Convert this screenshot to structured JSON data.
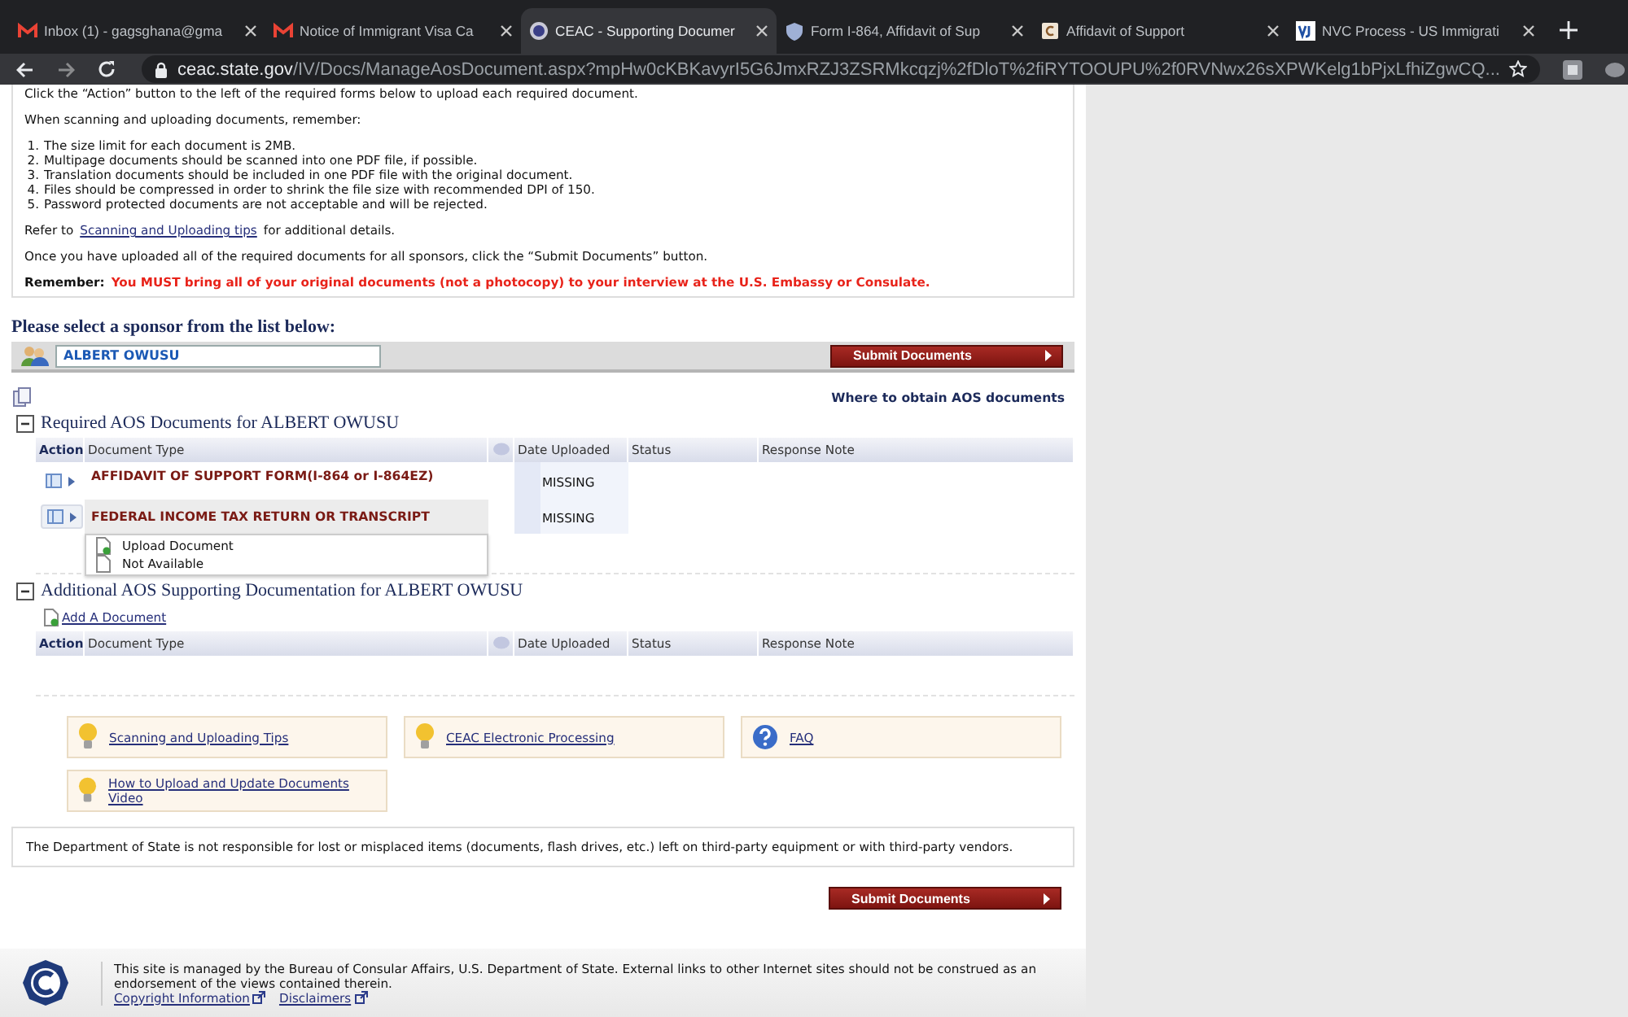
{
  "browser": {
    "tabs": [
      {
        "title": "Inbox (1) - gagsghana@gma",
        "kind": "gmail",
        "selected": false
      },
      {
        "title": "Notice of Immigrant Visa Ca",
        "kind": "gmail",
        "selected": false
      },
      {
        "title": "CEAC - Supporting Documer",
        "kind": "seal",
        "selected": true
      },
      {
        "title": "Form I-864, Affidavit of Sup",
        "kind": "shield",
        "selected": false
      },
      {
        "title": "Affidavit of Support",
        "kind": "letter",
        "selected": false
      },
      {
        "title": "NVC Process - US Immigrati",
        "kind": "vj",
        "selected": false
      }
    ],
    "address": {
      "domain": "ceac.state.gov",
      "path": "/IV/Docs/ManageAosDocument.aspx?mpHw0cKBKavyrI5G6JmxRZJ3ZSRMkcqzj%2fDloT%2fiRYTOOUPU%2f0RVNwx26sXPWKelg1bPjxLfhiZgwCQ..."
    }
  },
  "instructions": {
    "intro": "Click the “Action” button to the left of the required forms below to upload each required document.",
    "lead": "When scanning and uploading documents, remember:",
    "rules": [
      {
        "number": "1.",
        "text": "The size limit for each document is 2MB."
      },
      {
        "number": "2.",
        "text": "Multipage documents should be scanned into one PDF file, if possible."
      },
      {
        "number": "3.",
        "text": "Translation documents should be included in one PDF file with the original document."
      },
      {
        "number": "4.",
        "text": "Files should be compressed in order to shrink the file size with recommended DPI of 150."
      },
      {
        "number": "5.",
        "text": "Password protected documents are not acceptable and will be rejected."
      }
    ],
    "refer": {
      "before": "Refer to",
      "link": "Scanning and Uploading tips",
      "after": "for additional details."
    },
    "once": "Once you have uploaded all of the required documents for all sponsors, click the “Submit Documents” button.",
    "remember": {
      "label": "Remember:",
      "text": "You MUST bring all of your original documents (not a photocopy) to your interview at the U.S. Embassy or Consulate."
    }
  },
  "sponsor": {
    "heading": "Please select a sponsor from the list below:",
    "selected": "ALBERT OWUSU",
    "submit": "Submit Documents"
  },
  "where_link": "Where to obtain AOS documents",
  "required": {
    "expanded": true,
    "title": "Required AOS Documents for ALBERT OWUSU",
    "columns": [
      "Action",
      "Document Type",
      "Date Uploaded",
      "Status",
      "Response Note"
    ],
    "rows": [
      {
        "document_type": "AFFIDAVIT OF SUPPORT FORM(I-864 or I-864EZ)",
        "status": "MISSING",
        "highlighted": false
      },
      {
        "document_type": "FEDERAL INCOME TAX RETURN OR TRANSCRIPT",
        "status": "MISSING",
        "highlighted": true,
        "menu": [
          {
            "label": "Upload Document",
            "kind": "upload"
          },
          {
            "label": "Not Available",
            "kind": "blank"
          }
        ]
      }
    ]
  },
  "additional": {
    "expanded": true,
    "title": "Additional AOS Supporting Documentation for ALBERT OWUSU",
    "add_link": "Add A Document",
    "columns": [
      "Action",
      "Document Type",
      "Date Uploaded",
      "Status",
      "Response Note"
    ]
  },
  "help_links": [
    {
      "label": "Scanning and Uploading Tips",
      "kind": "bulb"
    },
    {
      "label": "CEAC Electronic Processing",
      "kind": "bulb"
    },
    {
      "label": "FAQ",
      "kind": "question"
    },
    {
      "label": "How to Upload and Update Documents Video",
      "kind": "bulb"
    }
  ],
  "disclaimer": "The Department of State is not responsible for lost or misplaced items (documents, flash drives, etc.) left on third-party equipment or with third-party vendors.",
  "submit_bottom": "Submit Documents",
  "footer": {
    "text": "This site is managed by the Bureau of Consular Affairs, U.S. Department of State. External links to other Internet sites should not be construed as an endorsement of the views contained therein.",
    "links": [
      "Copyright Information",
      "Disclaimers"
    ]
  }
}
